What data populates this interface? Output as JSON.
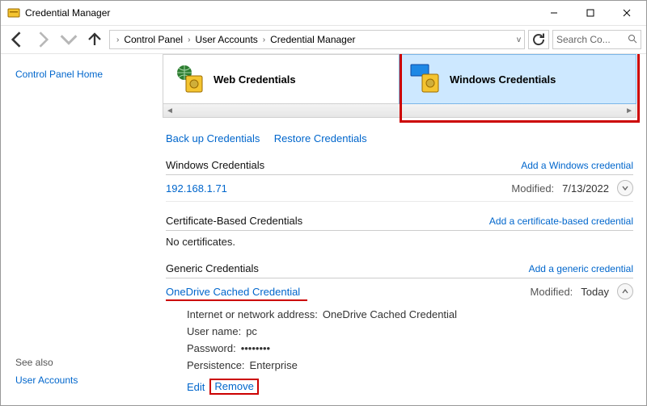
{
  "window": {
    "title": "Credential Manager"
  },
  "nav": {
    "breadcrumb": [
      "Control Panel",
      "User Accounts",
      "Credential Manager"
    ],
    "search_placeholder": "Search Co..."
  },
  "sidebar": {
    "home": "Control Panel Home",
    "see_also": "See also",
    "user_accounts": "User Accounts"
  },
  "tiles": {
    "web": "Web Credentials",
    "windows": "Windows Credentials"
  },
  "actions": {
    "backup": "Back up Credentials",
    "restore": "Restore Credentials"
  },
  "sections": {
    "windows": {
      "title": "Windows Credentials",
      "add": "Add a Windows credential",
      "entry": {
        "name": "192.168.1.71",
        "modified_label": "Modified:",
        "modified_value": "7/13/2022"
      }
    },
    "cert": {
      "title": "Certificate-Based Credentials",
      "add": "Add a certificate-based credential",
      "empty": "No certificates."
    },
    "generic": {
      "title": "Generic Credentials",
      "add": "Add a generic credential",
      "entry": {
        "name": "OneDrive Cached Credential",
        "modified_label": "Modified:",
        "modified_value": "Today"
      }
    }
  },
  "detail": {
    "addr_k": "Internet or network address:",
    "addr_v": "OneDrive Cached Credential",
    "user_k": "User name:",
    "user_v": "pc",
    "pass_k": "Password:",
    "pass_v": "••••••••",
    "pers_k": "Persistence:",
    "pers_v": "Enterprise",
    "edit": "Edit",
    "remove": "Remove"
  }
}
